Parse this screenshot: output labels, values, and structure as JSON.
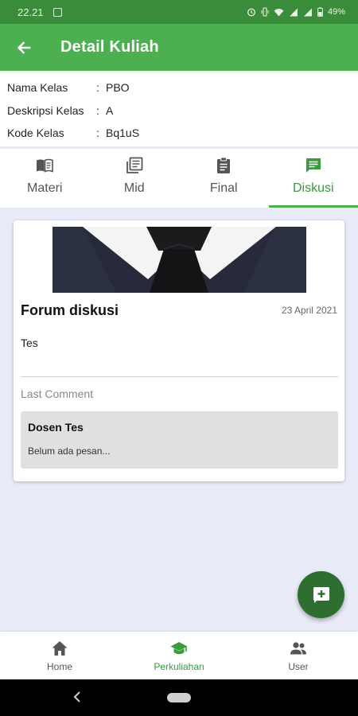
{
  "status_bar": {
    "time": "22.21",
    "battery": "49%"
  },
  "app_bar": {
    "title": "Detail Kuliah"
  },
  "class_info": {
    "rows": [
      {
        "label": "Nama Kelas",
        "sep": ":",
        "value": "PBO"
      },
      {
        "label": "Deskripsi Kelas",
        "sep": ":",
        "value": "A"
      },
      {
        "label": "Kode Kelas",
        "sep": ":",
        "value": "Bq1uS"
      }
    ]
  },
  "tabs": [
    {
      "label": "Materi",
      "icon": "book-open-icon",
      "active": false
    },
    {
      "label": "Mid",
      "icon": "library-books-icon",
      "active": false
    },
    {
      "label": "Final",
      "icon": "assignment-icon",
      "active": false
    },
    {
      "label": "Diskusi",
      "icon": "chat-icon",
      "active": true
    }
  ],
  "forum_card": {
    "title": "Forum diskusi",
    "date": "23 April 2021",
    "body": "Tes",
    "last_comment_label": "Last Comment",
    "comment": {
      "author": "Dosen Tes",
      "message": "Belum ada pesan..."
    }
  },
  "fab": {
    "icon": "add-box-icon"
  },
  "bottom_nav": [
    {
      "label": "Home",
      "icon": "home-icon",
      "active": false
    },
    {
      "label": "Perkuliahan",
      "icon": "school-icon",
      "active": true
    },
    {
      "label": "User",
      "icon": "people-icon",
      "active": false
    }
  ],
  "colors": {
    "primary": "#4caf50",
    "primary_dark": "#3b8c3a",
    "fab": "#2f6e31",
    "active_tab": "#3a9a3c",
    "background": "#e9ebf8"
  }
}
